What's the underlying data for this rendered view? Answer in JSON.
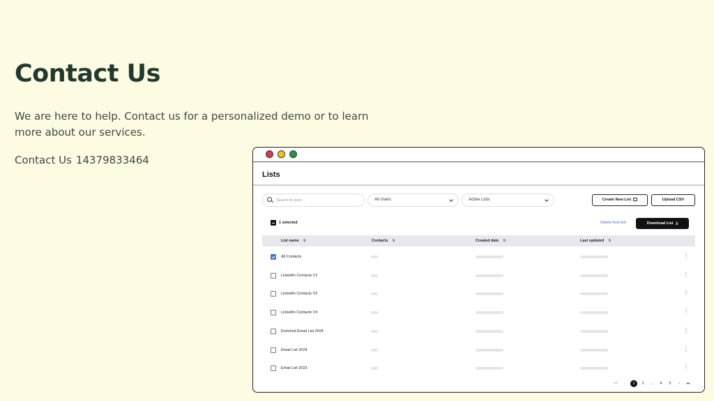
{
  "hero": {
    "title": "Contact Us",
    "description": "We are here to help. Contact us for a personalized demo or to learn more about our services.",
    "contact_label": "Contact Us",
    "phone": "14379833464"
  },
  "app": {
    "window_dots": [
      "red",
      "yellow",
      "green"
    ],
    "colors": {
      "accent": "#3f6fd6",
      "dark_button": "#111111",
      "page_bg": "#fefbe3"
    },
    "title": "Lists",
    "toolbar": {
      "search_placeholder": "Search for lists...",
      "users_select": "All Users",
      "status_select": "Active Lists",
      "create_button": "Create New List",
      "upload_button": "Upload CSV"
    },
    "selection": {
      "selected_text": "1 selected",
      "delete_link": "Delete from list",
      "download_button": "Download List"
    },
    "table": {
      "columns": [
        "List name",
        "Contacts",
        "Created date",
        "Last updated"
      ],
      "rows": [
        {
          "name": "All Contacts",
          "checked": true
        },
        {
          "name": "LinkedIn Contacts V1",
          "checked": false
        },
        {
          "name": "LinkedIn Contacts V2",
          "checked": false
        },
        {
          "name": "LinkedIn Contacts V3",
          "checked": false
        },
        {
          "name": "Enriched Email List 2024",
          "checked": false
        },
        {
          "name": "Email List 2024",
          "checked": false
        },
        {
          "name": "Email List 2023",
          "checked": false
        }
      ]
    },
    "pagination": {
      "first": "⏮",
      "prev": "‹",
      "pages": [
        "1",
        "2",
        "...",
        "4",
        "5"
      ],
      "current": "1",
      "next": "›",
      "last": "⏭"
    }
  }
}
